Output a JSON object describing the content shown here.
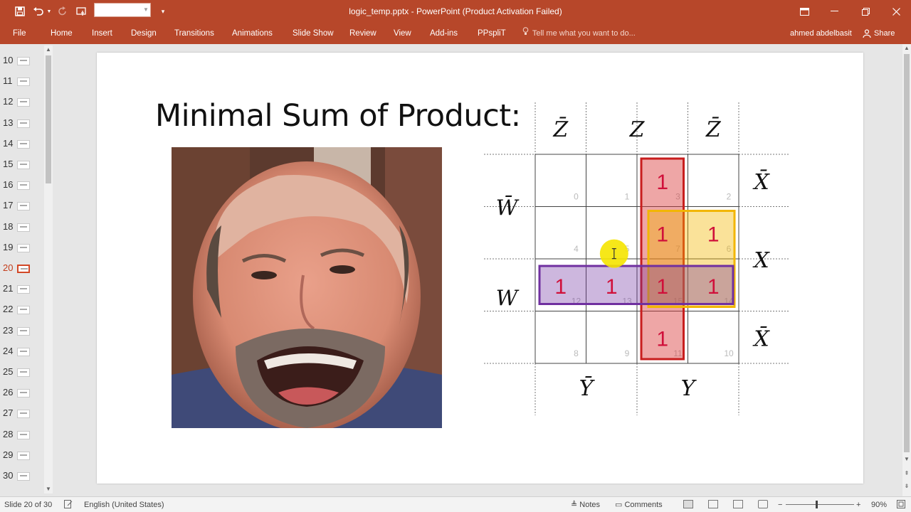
{
  "titlebar": {
    "title": "logic_temp.pptx - PowerPoint (Product Activation Failed)",
    "quick_access": {
      "save_icon": "save-icon",
      "undo_icon": "undo-icon",
      "redo_icon": "redo-icon",
      "touch_icon": "touch-mode-icon",
      "customize_icon": "customize-icon"
    },
    "window_controls": [
      "ribbon-display-icon",
      "minimize-icon",
      "restore-icon",
      "close-icon"
    ]
  },
  "ribbon": {
    "tabs": [
      "File",
      "Home",
      "Insert",
      "Design",
      "Transitions",
      "Animations",
      "Slide Show",
      "Review",
      "View",
      "Add-ins",
      "PPspliT"
    ],
    "tell_me": "Tell me what you want to do...",
    "user": "ahmed abdelbasit",
    "share": "Share"
  },
  "thumbnails": {
    "numbers": [
      "10",
      "11",
      "12",
      "13",
      "14",
      "15",
      "16",
      "17",
      "18",
      "19",
      "20",
      "21",
      "22",
      "23",
      "24",
      "25",
      "26",
      "27",
      "28",
      "29",
      "30"
    ],
    "active": "20"
  },
  "slide": {
    "title": "Minimal Sum of Product:",
    "kmap": {
      "col_labels": [
        "Z̄",
        "Z",
        "Z̄"
      ],
      "row_labels_right": [
        "X̄",
        "X",
        "X̄"
      ],
      "row_labels_left": [
        "W̄",
        "W"
      ],
      "bottom_labels": [
        "Ȳ",
        "Y"
      ],
      "cell_indices": [
        [
          "0",
          "1",
          "3",
          "2"
        ],
        [
          "4",
          "5",
          "7",
          "6"
        ],
        [
          "12",
          "13",
          "15",
          "14"
        ],
        [
          "8",
          "9",
          "11",
          "10"
        ]
      ],
      "cell_values": [
        [
          "",
          "",
          "1",
          ""
        ],
        [
          "",
          "",
          "1",
          "1"
        ],
        [
          "1",
          "1",
          "1",
          "1"
        ],
        [
          "",
          "",
          "1",
          ""
        ]
      ],
      "groups": [
        {
          "name": "red-column",
          "color": "#d93a3a"
        },
        {
          "name": "yellow-square",
          "color": "#f2b600"
        },
        {
          "name": "purple-row",
          "color": "#7030a0"
        }
      ],
      "one_color": "#d0103a"
    }
  },
  "status": {
    "slide_info": "Slide 20 of 30",
    "language": "English (United States)",
    "notes": "Notes",
    "comments": "Comments",
    "zoom": "90%"
  }
}
